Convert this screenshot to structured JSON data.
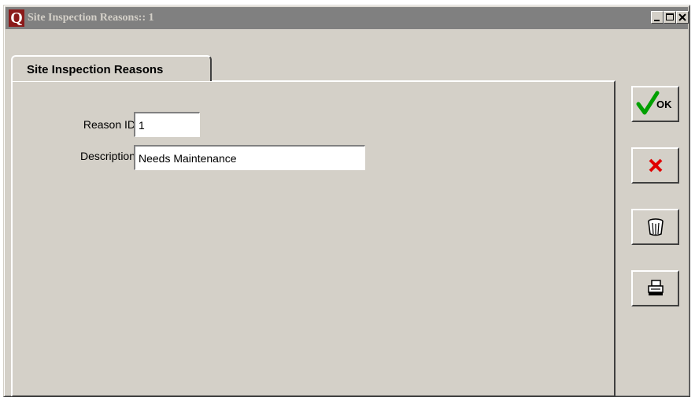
{
  "window": {
    "title": "Site Inspection Reasons:: 1",
    "app_icon_letter": "Q"
  },
  "title_controls": [
    "minimize-icon",
    "maximize-icon",
    "close-icon"
  ],
  "tab": {
    "label": "Site Inspection Reasons"
  },
  "form": {
    "reason_id": {
      "label": "Reason ID",
      "value": "1"
    },
    "description": {
      "label": "Description",
      "value": "Needs Maintenance"
    }
  },
  "side_buttons": {
    "ok": {
      "label": "OK",
      "icon": "checkmark-icon",
      "icon_color": "#00a000"
    },
    "cancel": {
      "icon": "red-x-icon",
      "icon_color": "#e00000"
    },
    "delete": {
      "icon": "trash-bin-icon"
    },
    "print": {
      "icon": "printer-icon"
    }
  },
  "colors": {
    "titlebar_bg": "#808080",
    "window_bg": "#d4d0c8",
    "app_icon_bg": "#8b1a1a"
  }
}
